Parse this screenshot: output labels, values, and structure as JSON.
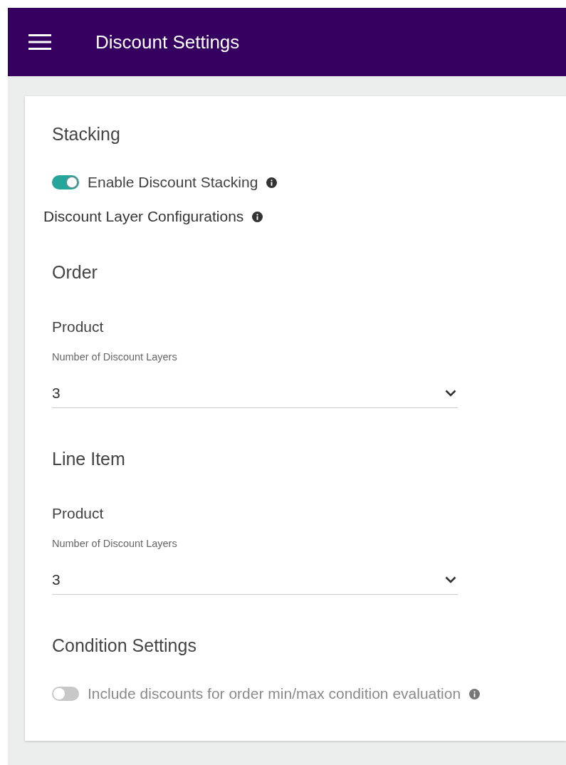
{
  "app_bar": {
    "title": "Discount Settings"
  },
  "stacking": {
    "heading": "Stacking",
    "toggle": {
      "label": "Enable Discount Stacking",
      "on": true,
      "disabled": false
    }
  },
  "layer_configurations": {
    "label": "Discount Layer Configurations",
    "groups": [
      {
        "heading": "Order",
        "fields": [
          {
            "title": "Product",
            "label": "Number of Discount Layers",
            "value": "3"
          }
        ]
      },
      {
        "heading": "Line Item",
        "fields": [
          {
            "title": "Product",
            "label": "Number of Discount Layers",
            "value": "3"
          }
        ]
      }
    ]
  },
  "condition_settings": {
    "heading": "Condition Settings",
    "toggle": {
      "label": "Include discounts for order min/max condition evaluation",
      "on": false,
      "disabled": true
    }
  }
}
